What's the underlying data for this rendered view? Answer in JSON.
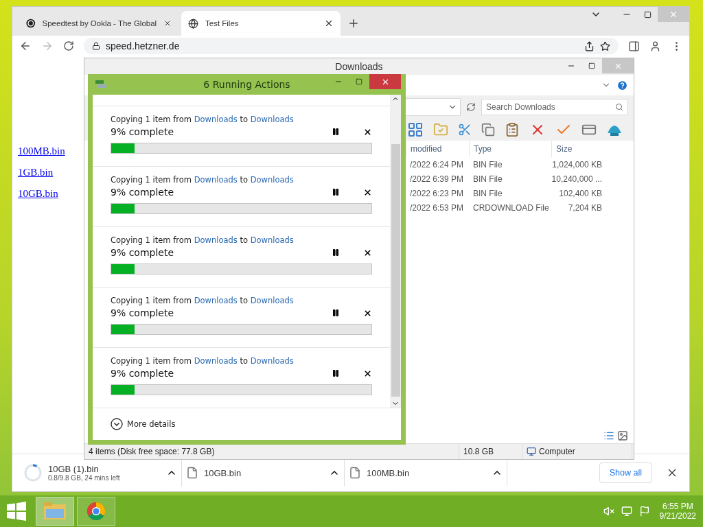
{
  "browser": {
    "tabs": [
      {
        "title": "Speedtest by Ookla - The Global",
        "kind": "speedtest",
        "selected": false
      },
      {
        "title": "Test Files",
        "kind": "globe",
        "selected": true
      }
    ],
    "address": "speed.hetzner.de",
    "links": [
      "100MB.bin",
      "1GB.bin",
      "10GB.bin"
    ],
    "downloads": [
      {
        "name": "10GB (1).bin",
        "status": "0.8/9.8 GB, 24 mins left",
        "kind": "active",
        "level": 0.08
      },
      {
        "name": "10GB.bin",
        "kind": "done"
      },
      {
        "name": "100MB.bin",
        "kind": "done"
      }
    ],
    "show_all": "Show all"
  },
  "explorer": {
    "title": "Downloads",
    "search": {
      "placeholder": "Search Downloads"
    },
    "columns": [
      "modified",
      "Type",
      "Size"
    ],
    "rows": [
      {
        "modified": "/2022 6:24 PM",
        "type": "BIN File",
        "size": "1,024,000 KB"
      },
      {
        "modified": "/2022 6:39 PM",
        "type": "BIN File",
        "size": "10,240,000 ..."
      },
      {
        "modified": "/2022 6:23 PM",
        "type": "BIN File",
        "size": "102,400 KB"
      },
      {
        "modified": "/2022 6:53 PM",
        "type": "CRDOWNLOAD File",
        "size": "7,204 KB"
      }
    ],
    "status": {
      "items": "4 items (Disk free space: 77.8 GB)",
      "size": "10.8 GB",
      "location": "Computer"
    }
  },
  "dialog": {
    "title": "6 Running Actions",
    "actions": [
      {
        "prefix": "Copying 1 item from",
        "source": "Downloads",
        "joiner": "to",
        "target": "Downloads",
        "progress": "9% complete",
        "level": 0.09
      },
      {
        "prefix": "Copying 1 item from",
        "source": "Downloads",
        "joiner": "to",
        "target": "Downloads",
        "progress": "9% complete",
        "level": 0.09
      },
      {
        "prefix": "Copying 1 item from",
        "source": "Downloads",
        "joiner": "to",
        "target": "Downloads",
        "progress": "9% complete",
        "level": 0.09
      },
      {
        "prefix": "Copying 1 item from",
        "source": "Downloads",
        "joiner": "to",
        "target": "Downloads",
        "progress": "9% complete",
        "level": 0.09
      },
      {
        "prefix": "Copying 1 item from",
        "source": "Downloads",
        "joiner": "to",
        "target": "Downloads",
        "progress": "9% complete",
        "level": 0.09
      }
    ],
    "more": "More details"
  },
  "taskbar": {
    "apps": [
      {
        "kind": "explorer",
        "selected": true
      },
      {
        "kind": "chrome",
        "selected": false
      }
    ],
    "time": "6:55 PM",
    "date": "9/21/2022"
  }
}
